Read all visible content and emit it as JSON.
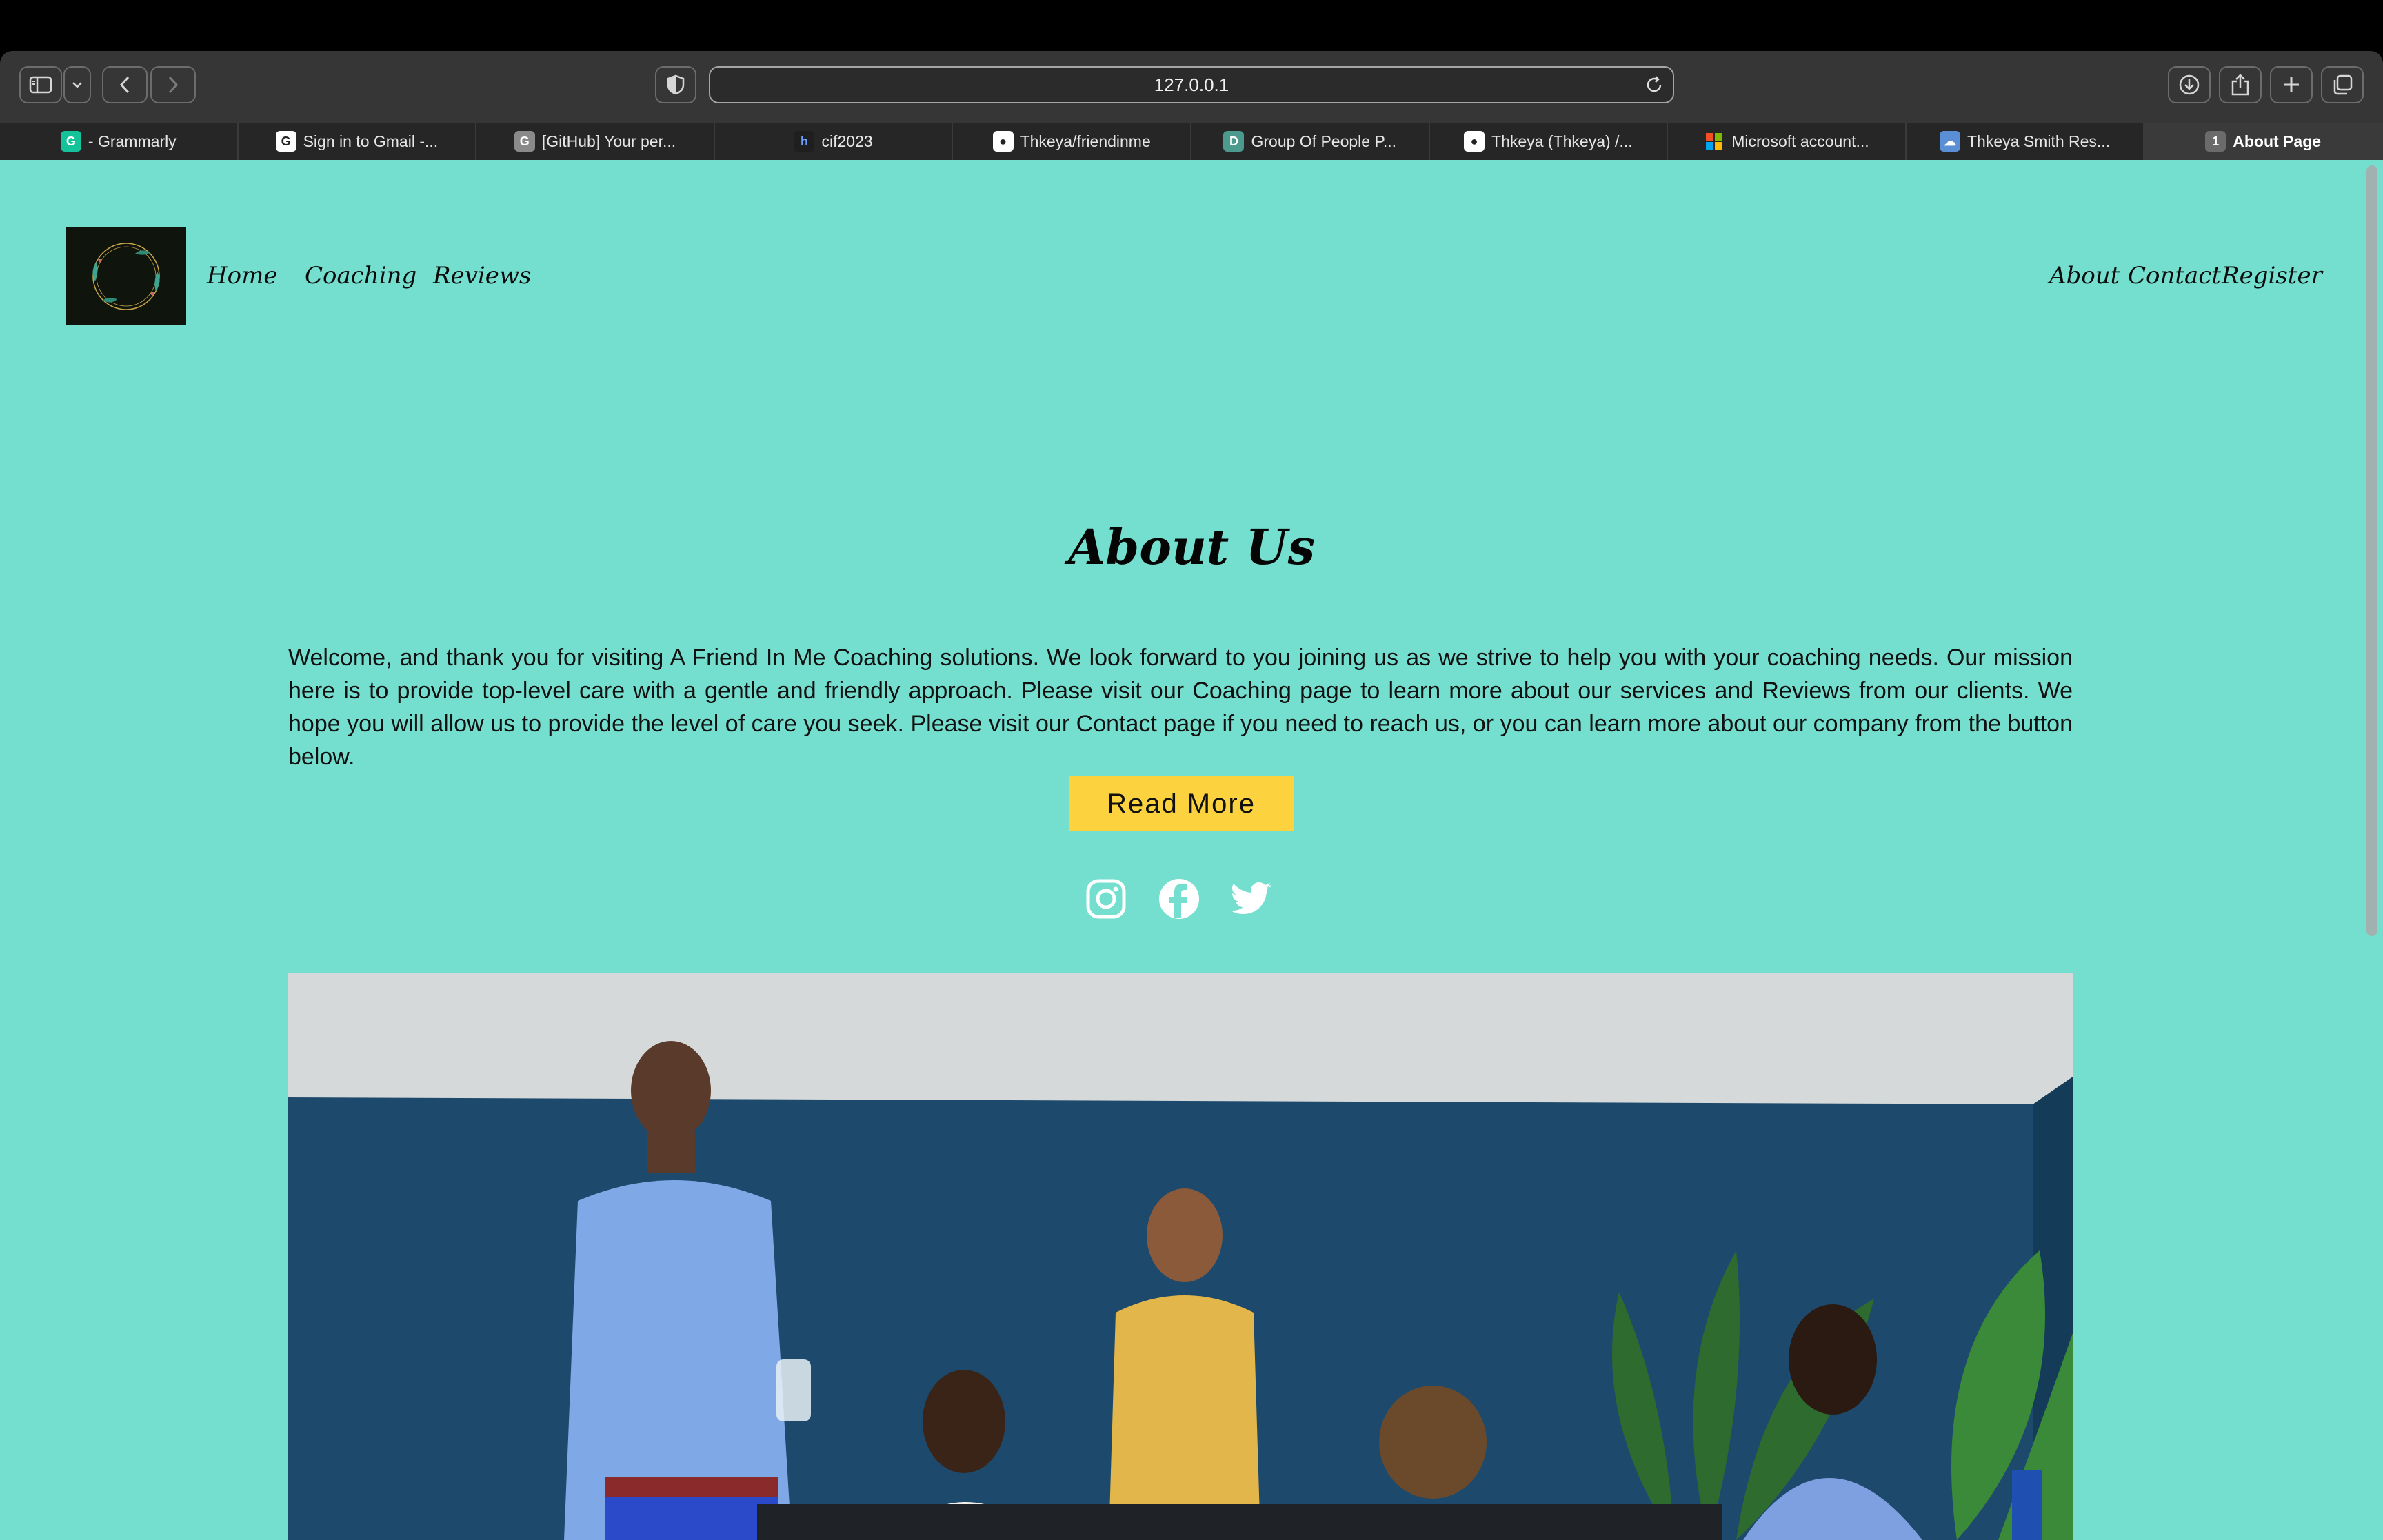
{
  "browser": {
    "url": "127.0.0.1",
    "tabs": [
      {
        "label": "- Grammarly",
        "icon": "grammarly-icon",
        "color": "#15c39a",
        "glyph": "G"
      },
      {
        "label": "Sign in to Gmail -...",
        "icon": "google-icon",
        "color": "#ffffff",
        "glyph": "G"
      },
      {
        "label": "[GitHub] Your per...",
        "icon": "gmail-g-icon",
        "color": "#8a8a8a",
        "glyph": "G"
      },
      {
        "label": "cif2023",
        "icon": "h-icon",
        "color": "#1f1f1f",
        "glyph": "h"
      },
      {
        "label": "Thkeya/friendinme",
        "icon": "github-icon",
        "color": "#ffffff",
        "glyph": "●"
      },
      {
        "label": "Group Of People P...",
        "icon": "d-icon",
        "color": "#4c9a8e",
        "glyph": "D"
      },
      {
        "label": "Thkeya (Thkeya) /...",
        "icon": "github-icon",
        "color": "#ffffff",
        "glyph": "●"
      },
      {
        "label": "Microsoft account...",
        "icon": "microsoft-icon",
        "color": "#f25022",
        "glyph": ""
      },
      {
        "label": "Thkeya Smith Res...",
        "icon": "cloud-icon",
        "color": "#5a8fd6",
        "glyph": "☁"
      },
      {
        "label": "About Page",
        "icon": "number-1-icon",
        "color": "#6b6b6b",
        "glyph": "1",
        "active": true
      }
    ]
  },
  "site": {
    "logo_text": "Friend in me",
    "nav_left": [
      "Home",
      "Coaching",
      "Reviews"
    ],
    "nav_right": [
      "About",
      "Contact",
      "Register"
    ],
    "title": "About Us",
    "body": "Welcome, and thank you for visiting A Friend In Me Coaching solutions. We look forward to you joining us as we strive to help you with your coaching needs. Our mission here is to provide top-level care with a gentle and friendly approach. Please visit our Coaching page to learn more about our services and Reviews from our clients. We hope you will allow us to provide the level of care you seek. Please visit our Contact page if you need to reach us, or you can learn more about our company from the button below.",
    "button": "Read More",
    "social": [
      "instagram-icon",
      "facebook-icon",
      "twitter-icon"
    ],
    "page_bg": "#75dfcf",
    "button_bg": "#fcd33f"
  }
}
